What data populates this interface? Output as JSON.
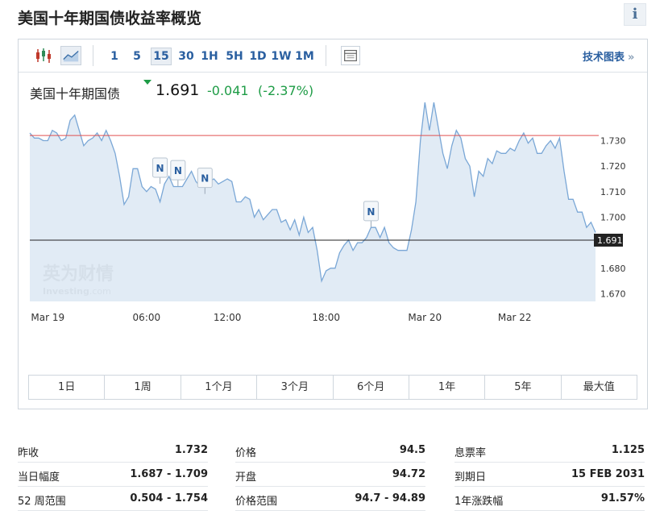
{
  "page": {
    "title": "美国十年期国债收益率概览",
    "info_icon": "i"
  },
  "toolbar": {
    "icons": [
      "candlestick-icon",
      "area-chart-icon",
      "table-icon"
    ],
    "timeframes": [
      "1",
      "5",
      "15",
      "30",
      "1H",
      "5H",
      "1D",
      "1W",
      "1M"
    ],
    "active_timeframe": "15",
    "tech_chart_label": "技术图表",
    "tech_chart_arrow": "»"
  },
  "quote": {
    "name": "美国十年期国债",
    "price": "1.691",
    "change": "-0.041",
    "change_pct": "(-2.37%)",
    "direction": "down"
  },
  "chart_data": {
    "type": "area",
    "title": "",
    "xlabel": "",
    "ylabel": "",
    "x_tick_labels": [
      "Mar 19",
      "06:00",
      "12:00",
      "18:00",
      "Mar 20",
      "Mar 22"
    ],
    "y_tick_labels": [
      "1.730",
      "1.720",
      "1.710",
      "1.700",
      "1.690",
      "1.680",
      "1.670"
    ],
    "ylim": [
      1.667,
      1.745
    ],
    "grid": false,
    "reference_lines": [
      {
        "label": "previous close",
        "value": 1.732,
        "color": "#e05050"
      },
      {
        "label": "last price",
        "value": 1.691,
        "color": "#222222"
      }
    ],
    "last_value_label": "1.691",
    "series": [
      {
        "values": [
          1.733,
          1.731,
          1.731,
          1.73,
          1.73,
          1.734,
          1.733,
          1.73,
          1.731,
          1.738,
          1.74,
          1.734,
          1.728,
          1.73,
          1.731,
          1.733,
          1.73,
          1.734,
          1.73,
          1.725,
          1.716,
          1.705,
          1.708,
          1.719,
          1.719,
          1.712,
          1.71,
          1.712,
          1.711,
          1.706,
          1.713,
          1.716,
          1.712,
          1.712,
          1.712,
          1.715,
          1.718,
          1.714,
          1.712,
          1.713,
          1.714,
          1.715,
          1.713,
          1.714,
          1.715,
          1.714,
          1.706,
          1.706,
          1.708,
          1.707,
          1.7,
          1.703,
          1.699,
          1.701,
          1.703,
          1.703,
          1.698,
          1.699,
          1.695,
          1.699,
          1.693,
          1.7,
          1.694,
          1.696,
          1.687,
          1.675,
          1.679,
          1.68,
          1.68,
          1.686,
          1.689,
          1.691,
          1.687,
          1.69,
          1.69,
          1.692,
          1.696,
          1.696,
          1.692,
          1.696,
          1.69,
          1.688,
          1.687,
          1.687,
          1.687,
          1.695,
          1.706,
          1.73,
          1.745,
          1.734,
          1.745,
          1.735,
          1.725,
          1.719,
          1.728,
          1.734,
          1.731,
          1.723,
          1.72,
          1.708,
          1.718,
          1.716,
          1.723,
          1.721,
          1.726,
          1.725,
          1.725,
          1.727,
          1.726,
          1.73,
          1.733,
          1.729,
          1.731,
          1.725,
          1.725,
          1.728,
          1.73,
          1.727,
          1.731,
          1.718,
          1.707,
          1.707,
          1.702,
          1.702,
          1.696,
          1.698,
          1.694
        ],
        "color": "#7aa7d6"
      }
    ],
    "news_markers": [
      "N",
      "N",
      "N",
      "N"
    ],
    "watermark": {
      "brand_cn": "英为财情",
      "brand_en": "Investing",
      "brand_suffix": ".com"
    }
  },
  "range_buttons": [
    "1日",
    "1周",
    "1个月",
    "3个月",
    "6个月",
    "1年",
    "5年",
    "最大值"
  ],
  "stats": [
    [
      {
        "label": "昨收",
        "value": "1.732"
      },
      {
        "label": "当日幅度",
        "value": "1.687 - 1.709"
      },
      {
        "label": "52 周范围",
        "value": "0.504 - 1.754"
      }
    ],
    [
      {
        "label": "价格",
        "value": "94.5"
      },
      {
        "label": "开盘",
        "value": "94.72"
      },
      {
        "label": "价格范围",
        "value": "94.7 - 94.89"
      }
    ],
    [
      {
        "label": "息票率",
        "value": "1.125"
      },
      {
        "label": "到期日",
        "value": "15 FEB 2031"
      },
      {
        "label": "1年涨跌幅",
        "value": "91.57%"
      }
    ]
  ]
}
